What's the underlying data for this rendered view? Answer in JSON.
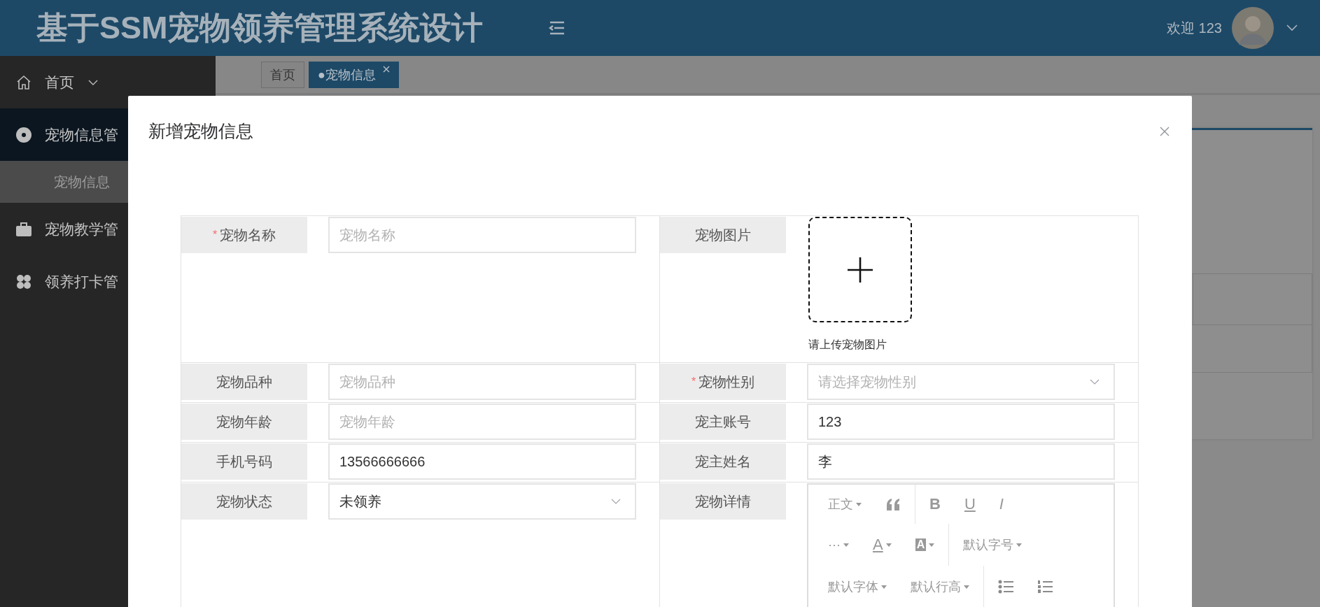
{
  "header": {
    "title": "基于SSM宠物领养管理系统设计",
    "welcome": "欢迎 123"
  },
  "sidebar": {
    "items": [
      {
        "label": "首页",
        "selected": false,
        "expanded": false
      },
      {
        "label": "宠物信息管",
        "selected": true,
        "children": [
          {
            "label": "宠物信息",
            "selected": true
          }
        ]
      },
      {
        "label": "宠物教学管",
        "selected": false
      },
      {
        "label": "领养打卡管",
        "selected": false
      }
    ]
  },
  "tabs": [
    {
      "label": "首页",
      "selected": false,
      "closable": false
    },
    {
      "label": "●宠物信息",
      "selected": true,
      "closable": true
    }
  ],
  "dialog": {
    "title": "新增宠物信息",
    "left": [
      {
        "kind": "input",
        "label": "宠物名称",
        "required_mark": "*",
        "placeholder": "宠物名称"
      },
      {
        "kind": "input",
        "label": "宠物品种",
        "placeholder": "宠物品种"
      },
      {
        "kind": "input",
        "label": "宠物年龄",
        "placeholder": "宠物年龄"
      },
      {
        "kind": "input",
        "label": "手机号码",
        "value": "13566666666"
      },
      {
        "kind": "select",
        "label": "宠物状态",
        "value": "未领养"
      }
    ],
    "right": [
      {
        "kind": "upload",
        "label": "宠物图片",
        "hint": "请上传宠物图片"
      },
      {
        "kind": "select",
        "label": "宠物性别",
        "required_mark": "*",
        "placeholder": "请选择宠物性别"
      },
      {
        "kind": "input",
        "label": "宠主账号",
        "value": "123"
      },
      {
        "kind": "input",
        "label": "宠主姓名",
        "value": "李"
      },
      {
        "kind": "editor",
        "label": "宠物详情",
        "toolbar": [
          [
            [
              {
                "kind": "menu",
                "label": "正文"
              },
              {
                "kind": "quote"
              }
            ],
            [
              {
                "kind": "bold",
                "label": "B"
              },
              {
                "kind": "underline",
                "label": "U"
              },
              {
                "kind": "italic",
                "label": "I"
              }
            ]
          ],
          [
            [
              {
                "kind": "more",
                "label": "···"
              },
              {
                "kind": "fontcolor",
                "label": "A"
              },
              {
                "kind": "bgcolor",
                "label": "A"
              }
            ],
            [
              {
                "kind": "menu",
                "label": "默认字号"
              }
            ]
          ],
          [
            [
              {
                "kind": "menu",
                "label": "默认字体"
              },
              {
                "kind": "menu",
                "label": "默认行高"
              }
            ],
            [
              {
                "kind": "bullet-list"
              },
              {
                "kind": "number-list"
              }
            ]
          ]
        ]
      }
    ]
  }
}
